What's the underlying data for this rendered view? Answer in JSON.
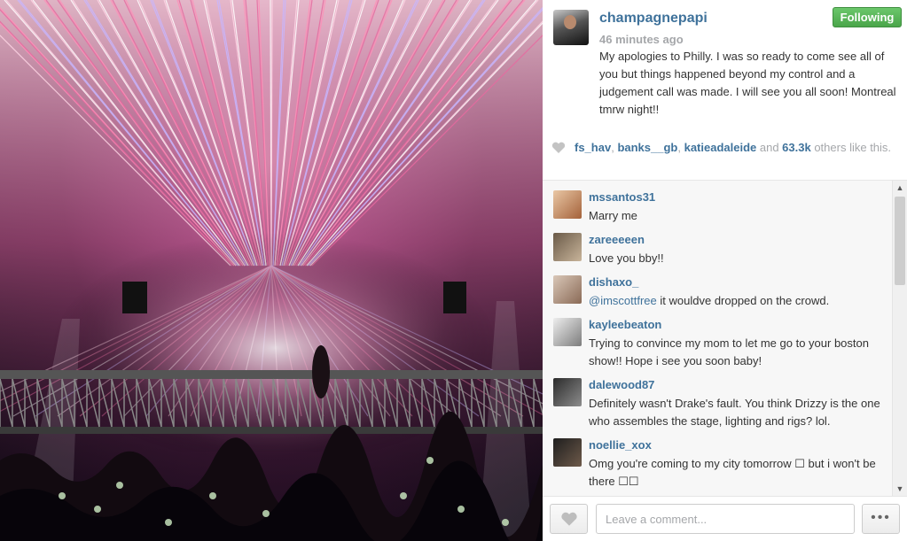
{
  "post": {
    "photo_alt": "concert stage with laser light show",
    "username": "champagnepapi",
    "timestamp": "46 minutes ago",
    "follow_label": "Following",
    "caption": "My apologies to Philly. I was so ready to come see all of you but things happened beyond my control and a judgement call was made. I will see you all soon! Montreal tmrw night!!"
  },
  "likes": {
    "users": [
      "fs_hav",
      "banks__gb",
      "katieadaleide"
    ],
    "sep1": ", ",
    "sep2": ", ",
    "and_text": " and ",
    "count": "63.3k",
    "suffix": " others like this."
  },
  "comments": [
    {
      "user": "mssantos31",
      "text": "Marry me"
    },
    {
      "user": "zareeeeen",
      "text": "Love you bby!!"
    },
    {
      "user": "dishaxo_",
      "mention": "@imscottfree",
      "text": " it wouldve dropped on the crowd."
    },
    {
      "user": "kayleebeaton",
      "text": "Trying to convince my mom to let me go to your boston show!! Hope i see you soon baby!"
    },
    {
      "user": "dalewood87",
      "text": "Definitely wasn't Drake's fault. You think Drizzy is the one who assembles the stage, lighting and rigs? lol."
    },
    {
      "user": "noellie_xox",
      "text": "Omg you're coming to my city tomorrow ☐ but i won't be there ☐☐"
    }
  ],
  "footer": {
    "comment_placeholder": "Leave a comment...",
    "more_label": "•••"
  },
  "scrollbar": {
    "up_glyph": "▲",
    "down_glyph": "▼"
  },
  "icons": {
    "like_heart_small": "heart-icon",
    "like_button": "heart-icon"
  },
  "colors": {
    "link": "#3f729b",
    "following_green": "#4aa54a",
    "muted": "#a5a7aa"
  }
}
